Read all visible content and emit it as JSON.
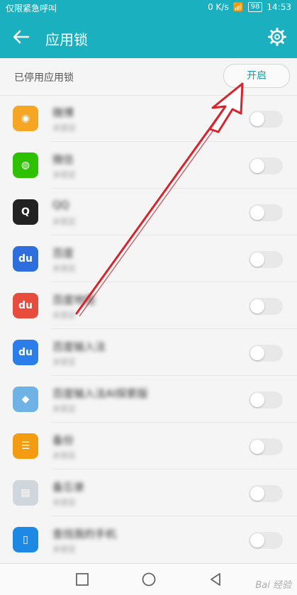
{
  "status_bar": {
    "left_text": "仅限紧急呼叫",
    "speed": "0 K/s",
    "battery": "98",
    "time": "14:53"
  },
  "app_bar": {
    "title": "应用锁",
    "back_icon": "back-arrow-icon",
    "settings_icon": "gear-icon"
  },
  "section": {
    "label": "已停用应用锁",
    "button_label": "开启"
  },
  "apps": [
    {
      "name": "微博",
      "sub": "未锁定",
      "icon_color": "#f5a623",
      "icon_char": "◉"
    },
    {
      "name": "微信",
      "sub": "未锁定",
      "icon_color": "#2dc100",
      "icon_char": "◍"
    },
    {
      "name": "QQ",
      "sub": "未锁定",
      "icon_color": "#222222",
      "icon_char": "Q"
    },
    {
      "name": "百度",
      "sub": "未锁定",
      "icon_color": "#2f6fdd",
      "icon_char": "du"
    },
    {
      "name": "百度地图",
      "sub": "未锁定",
      "icon_color": "#e74c3c",
      "icon_char": "du"
    },
    {
      "name": "百度输入法",
      "sub": "未锁定",
      "icon_color": "#2b7de9",
      "icon_char": "du"
    },
    {
      "name": "百度输入法AI探索版",
      "sub": "未锁定",
      "icon_color": "#6fb3e6",
      "icon_char": "◆"
    },
    {
      "name": "备份",
      "sub": "未锁定",
      "icon_color": "#f39c12",
      "icon_char": "☰"
    },
    {
      "name": "备忘录",
      "sub": "未锁定",
      "icon_color": "#cfd6dc",
      "icon_char": "▤"
    },
    {
      "name": "查找我的手机",
      "sub": "未锁定",
      "icon_color": "#1e88e5",
      "icon_char": "▯"
    }
  ],
  "watermark": "Bai 经验"
}
